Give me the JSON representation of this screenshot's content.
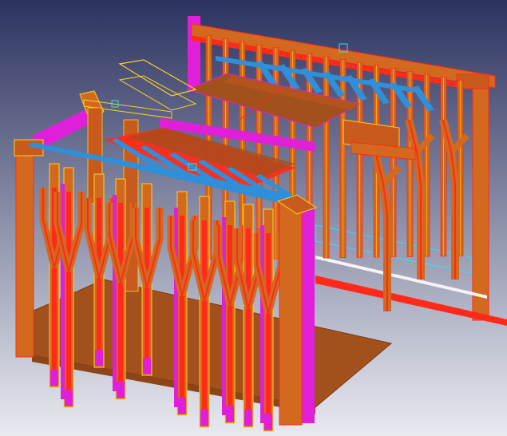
{
  "viewport": {
    "background_top": "#2c3360",
    "background_bottom": "#e9eaf0"
  },
  "colors": {
    "steel_orange": "#d2691e",
    "slab_brown": "#b5531d",
    "deck_brown": "#a2501c",
    "magenta": "#e020d8",
    "blue_beam": "#2f8fd8",
    "red_member": "#ff2a1a",
    "yellow_line": "#ffd21e",
    "cyan_line": "#35e0f0",
    "wire_white": "#f4f4f4"
  }
}
